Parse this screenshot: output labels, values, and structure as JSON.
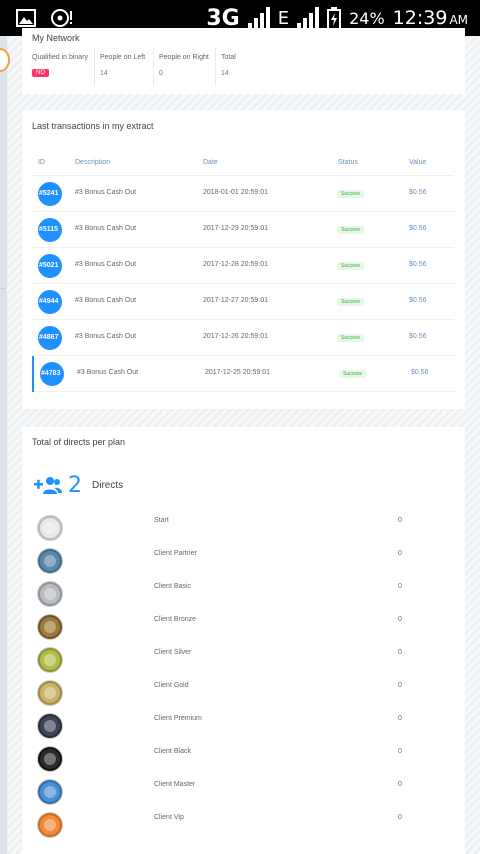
{
  "status_bar": {
    "network": "3G",
    "network2": "E",
    "battery": "24%",
    "time": "12:39",
    "ampm": "AM"
  },
  "network": {
    "title": "My Network",
    "cols": [
      {
        "label": "Qualified in binary",
        "value": "NO"
      },
      {
        "label": "People on Left",
        "value": "14"
      },
      {
        "label": "People on Right",
        "value": "0"
      },
      {
        "label": "Total",
        "value": "14"
      }
    ]
  },
  "transactions": {
    "title": "Last transactions in my extract",
    "headers": [
      "ID",
      "Description",
      "Date",
      "Status",
      "Value"
    ],
    "rows": [
      {
        "id": "#5241",
        "desc": "#3 Bonus Cash Out",
        "date": "2018-01-01 20:59:01",
        "status": "Success",
        "value": "$0.56"
      },
      {
        "id": "#5115",
        "desc": "#3 Bonus Cash Out",
        "date": "2017-12-29 20:59:01",
        "status": "Success",
        "value": "$0.56"
      },
      {
        "id": "#5021",
        "desc": "#3 Bonus Cash Out",
        "date": "2017-12-28 20:59:01",
        "status": "Success",
        "value": "$0.56"
      },
      {
        "id": "#4944",
        "desc": "#3 Bonus Cash Out",
        "date": "2017-12-27 20:59:01",
        "status": "Success",
        "value": "$0.56"
      },
      {
        "id": "#4867",
        "desc": "#3 Bonus Cash Out",
        "date": "2017-12-26 20:59:01",
        "status": "Success",
        "value": "$0.56"
      },
      {
        "id": "#4783",
        "desc": "#3 Bonus Cash Out",
        "date": "2017-12-25 20:59:01",
        "status": "Success",
        "value": "$0.56"
      }
    ]
  },
  "directs": {
    "title": "Total of directs per plan",
    "count": "2",
    "label": "Directs",
    "plans": [
      {
        "name": "Start",
        "count": "0",
        "color": "#e8e8e8",
        "ring": "#bbbbbb"
      },
      {
        "name": "Client Partner",
        "count": "0",
        "color": "#5a86a8",
        "ring": "#3d6b8c"
      },
      {
        "name": "Client Basic",
        "count": "0",
        "color": "#b8bcc0",
        "ring": "#8f9499"
      },
      {
        "name": "Client Bronze",
        "count": "0",
        "color": "#9c7a3a",
        "ring": "#6e5422"
      },
      {
        "name": "Client Silver",
        "count": "0",
        "color": "#b5bd4a",
        "ring": "#8b9230"
      },
      {
        "name": "Client Gold",
        "count": "0",
        "color": "#c9b26a",
        "ring": "#a38c3e"
      },
      {
        "name": "Client Premium",
        "count": "0",
        "color": "#3c4456",
        "ring": "#262c38"
      },
      {
        "name": "Client Black",
        "count": "0",
        "color": "#2b2b2b",
        "ring": "#111111"
      },
      {
        "name": "Client Master",
        "count": "0",
        "color": "#4a8fd0",
        "ring": "#2f6eab"
      },
      {
        "name": "Client Vip",
        "count": "0",
        "color": "#f08a3c",
        "ring": "#d06a1c"
      }
    ]
  }
}
